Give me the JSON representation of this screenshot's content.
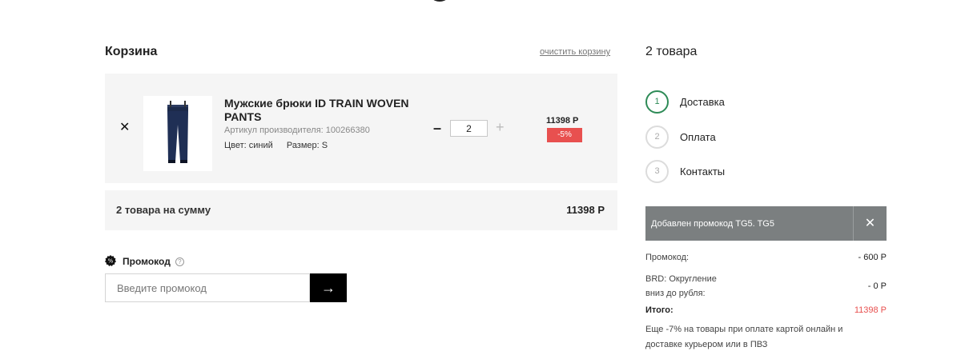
{
  "cart": {
    "title": "Корзина",
    "clear_label": "очистить корзину",
    "item": {
      "name": "Мужские брюки ID TRAIN WOVEN PANTS",
      "article": "Артикул производителя: 100266380",
      "color": "Цвет: синий",
      "size": "Размер: S",
      "quantity": "2",
      "price": "11398 Р",
      "discount": "-5%"
    },
    "summary": {
      "label": "2 товара на сумму",
      "value": "11398 Р"
    },
    "promo": {
      "label": "Промокод",
      "placeholder": "Введите промокод",
      "submit_icon": "arrow-right-icon"
    }
  },
  "order": {
    "items_count": "2 товара",
    "steps": [
      {
        "number": "1",
        "label": "Доставка",
        "active": true
      },
      {
        "number": "2",
        "label": "Оплата",
        "active": false
      },
      {
        "number": "3",
        "label": "Контакты",
        "active": false
      }
    ],
    "applied_promo": "Добавлен промокод TG5. TG5",
    "totals": {
      "promo_label": "Промокод:",
      "promo_value": "- 600 Р",
      "rounding_label_1": "BRD: Округление",
      "rounding_label_2": "вниз до рубля:",
      "rounding_value": "- 0 Р",
      "total_label": "Итого:",
      "total_value": "11398 Р"
    },
    "note": "Еще -7% на товары при оплате картой онлайн и доставке курьером или в ПВЗ"
  },
  "colors": {
    "accent_green": "#2e8b57",
    "discount_red": "#e8504f",
    "promo_bar": "#7b7f80"
  }
}
